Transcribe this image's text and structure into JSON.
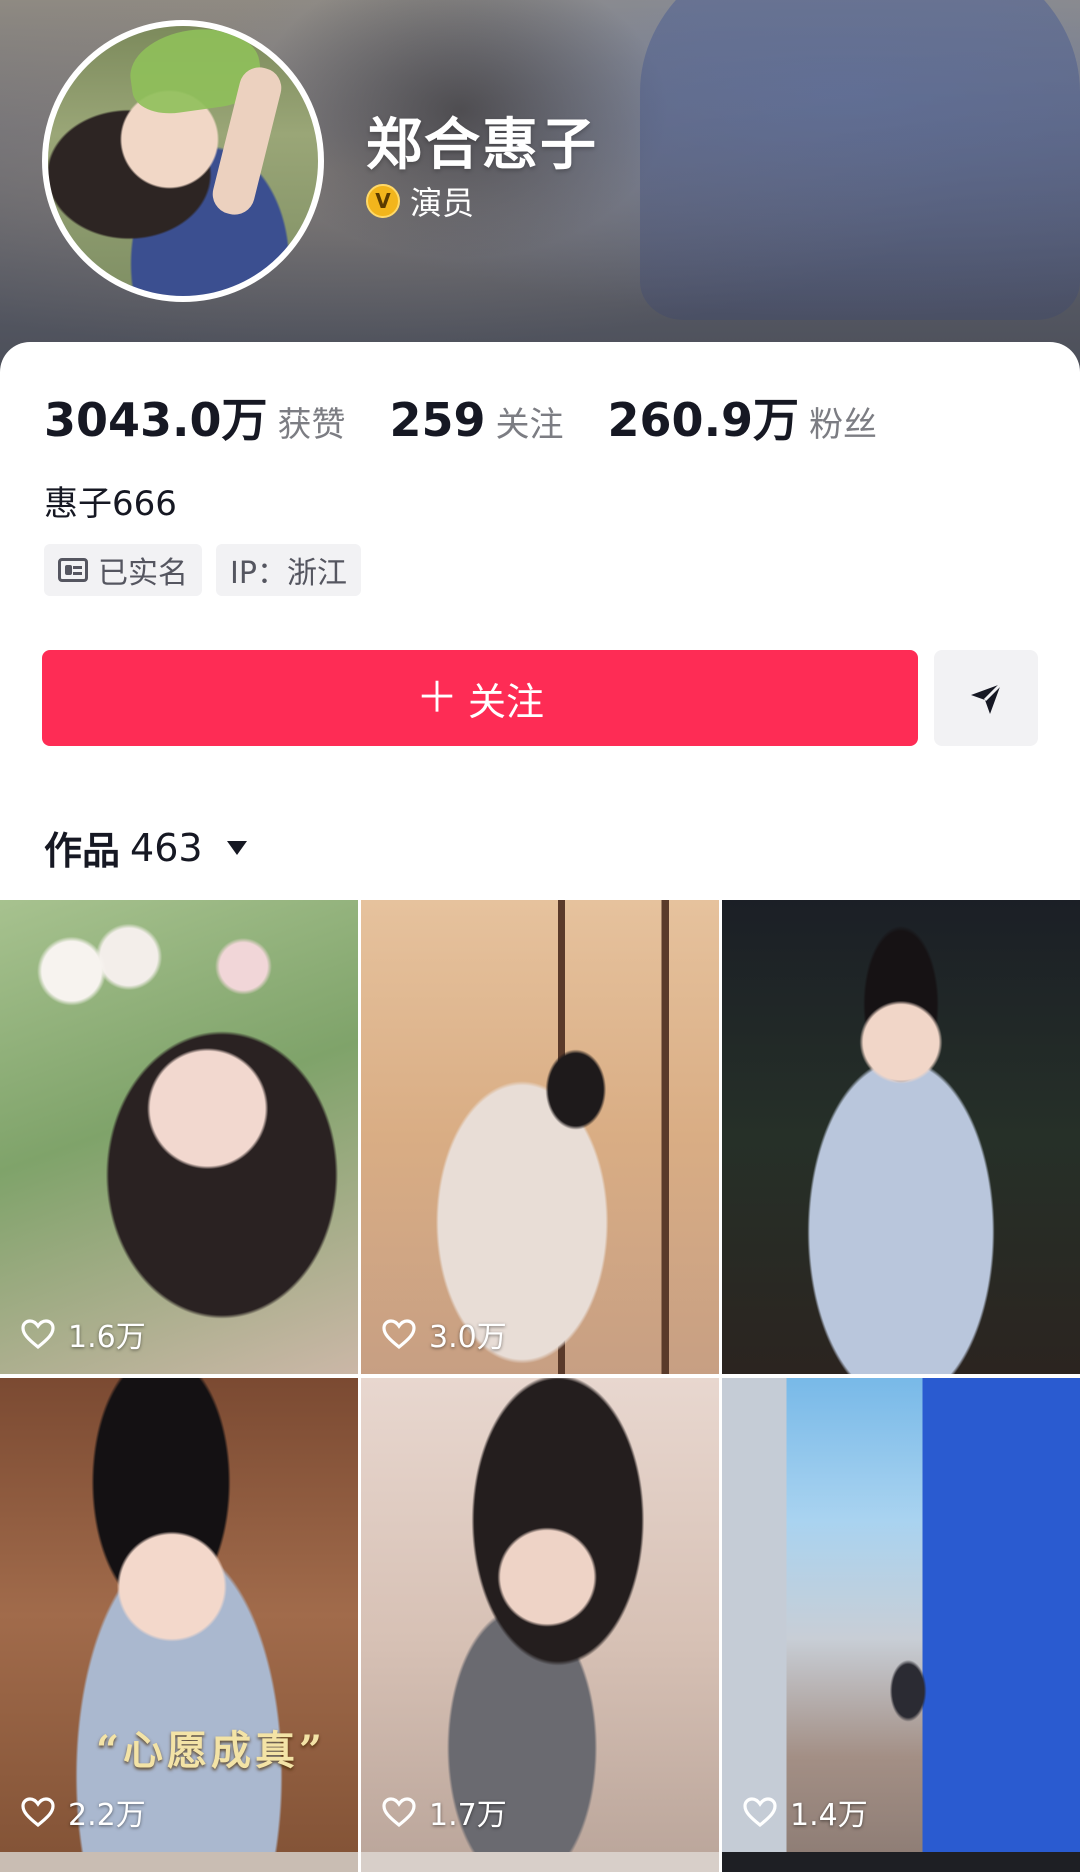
{
  "profile": {
    "name": "郑合惠子",
    "verify_label": "演员",
    "bio": "惠子666",
    "tags": [
      "已实名",
      "IP：浙江"
    ]
  },
  "stats": [
    {
      "value": "3043.0万",
      "label": "获赞"
    },
    {
      "value": "259",
      "label": "关注"
    },
    {
      "value": "260.9万",
      "label": "粉丝"
    }
  ],
  "actions": {
    "follow_plus": "＋",
    "follow_label": "关注"
  },
  "works": {
    "label": "作品",
    "count": "463"
  },
  "videos": [
    {
      "likes": "1.6万"
    },
    {
      "likes": "3.0万"
    },
    {
      "likes": ""
    },
    {
      "likes": "2.2万",
      "caption": "“心愿成真”"
    },
    {
      "likes": "1.7万"
    },
    {
      "likes": "1.4万"
    }
  ],
  "colors": {
    "accent": "#fe2c55",
    "verify_badge": "#f2b51c",
    "text_primary": "#161823",
    "text_secondary": "#7c7d83"
  },
  "icons": [
    "verified-v-icon",
    "id-card-icon",
    "plus-icon",
    "share-send-icon",
    "caret-down-icon",
    "heart-icon"
  ]
}
